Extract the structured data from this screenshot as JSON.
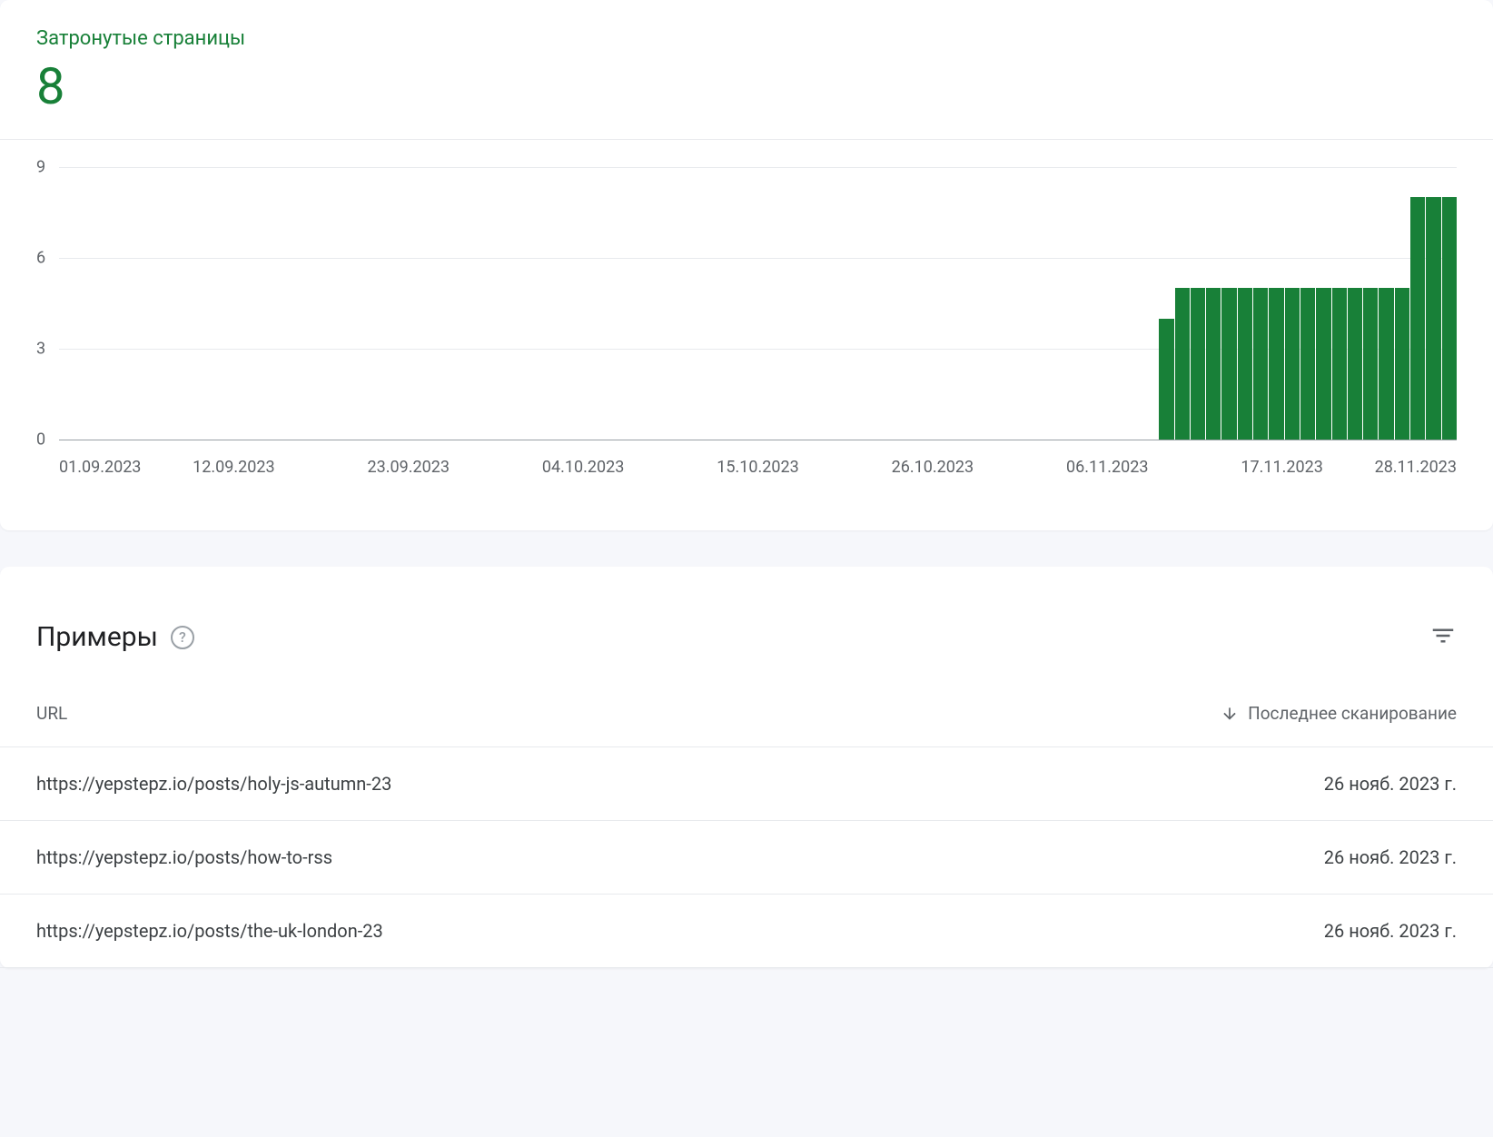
{
  "metric": {
    "label": "Затронутые страницы",
    "value": "8"
  },
  "chart_data": {
    "type": "bar",
    "title": "",
    "xlabel": "",
    "ylabel": "",
    "ylim": [
      0,
      9
    ],
    "y_ticks": [
      0,
      3,
      6,
      9
    ],
    "x_ticks": [
      "01.09.2023",
      "12.09.2023",
      "23.09.2023",
      "04.10.2023",
      "15.10.2023",
      "26.10.2023",
      "06.11.2023",
      "17.11.2023",
      "28.11.2023"
    ],
    "categories": [
      "01.09.2023",
      "02.09.2023",
      "03.09.2023",
      "04.09.2023",
      "05.09.2023",
      "06.09.2023",
      "07.09.2023",
      "08.09.2023",
      "09.09.2023",
      "10.09.2023",
      "11.09.2023",
      "12.09.2023",
      "13.09.2023",
      "14.09.2023",
      "15.09.2023",
      "16.09.2023",
      "17.09.2023",
      "18.09.2023",
      "19.09.2023",
      "20.09.2023",
      "21.09.2023",
      "22.09.2023",
      "23.09.2023",
      "24.09.2023",
      "25.09.2023",
      "26.09.2023",
      "27.09.2023",
      "28.09.2023",
      "29.09.2023",
      "30.09.2023",
      "01.10.2023",
      "02.10.2023",
      "03.10.2023",
      "04.10.2023",
      "05.10.2023",
      "06.10.2023",
      "07.10.2023",
      "08.10.2023",
      "09.10.2023",
      "10.10.2023",
      "11.10.2023",
      "12.10.2023",
      "13.10.2023",
      "14.10.2023",
      "15.10.2023",
      "16.10.2023",
      "17.10.2023",
      "18.10.2023",
      "19.10.2023",
      "20.10.2023",
      "21.10.2023",
      "22.10.2023",
      "23.10.2023",
      "24.10.2023",
      "25.10.2023",
      "26.10.2023",
      "27.10.2023",
      "28.10.2023",
      "29.10.2023",
      "30.10.2023",
      "31.10.2023",
      "01.11.2023",
      "02.11.2023",
      "03.11.2023",
      "04.11.2023",
      "05.11.2023",
      "06.11.2023",
      "07.11.2023",
      "08.11.2023",
      "09.11.2023",
      "10.11.2023",
      "11.11.2023",
      "12.11.2023",
      "13.11.2023",
      "14.11.2023",
      "15.11.2023",
      "16.11.2023",
      "17.11.2023",
      "18.11.2023",
      "19.11.2023",
      "20.11.2023",
      "21.11.2023",
      "22.11.2023",
      "23.11.2023",
      "24.11.2023",
      "25.11.2023",
      "26.11.2023",
      "27.11.2023",
      "28.11.2023"
    ],
    "values": [
      0,
      0,
      0,
      0,
      0,
      0,
      0,
      0,
      0,
      0,
      0,
      0,
      0,
      0,
      0,
      0,
      0,
      0,
      0,
      0,
      0,
      0,
      0,
      0,
      0,
      0,
      0,
      0,
      0,
      0,
      0,
      0,
      0,
      0,
      0,
      0,
      0,
      0,
      0,
      0,
      0,
      0,
      0,
      0,
      0,
      0,
      0,
      0,
      0,
      0,
      0,
      0,
      0,
      0,
      0,
      0,
      0,
      0,
      0,
      0,
      0,
      0,
      0,
      0,
      0,
      0,
      0,
      0,
      0,
      0,
      4,
      5,
      5,
      5,
      5,
      5,
      5,
      5,
      5,
      5,
      5,
      5,
      5,
      5,
      5,
      5,
      8,
      8,
      8
    ],
    "color": "#188038"
  },
  "examples": {
    "title": "Примеры",
    "columns": {
      "url": "URL",
      "last_crawl": "Последнее сканирование"
    },
    "rows": [
      {
        "url": "https://yepstepz.io/posts/holy-js-autumn-23",
        "date": "26 нояб. 2023 г."
      },
      {
        "url": "https://yepstepz.io/posts/how-to-rss",
        "date": "26 нояб. 2023 г."
      },
      {
        "url": "https://yepstepz.io/posts/the-uk-london-23",
        "date": "26 нояб. 2023 г."
      }
    ]
  }
}
